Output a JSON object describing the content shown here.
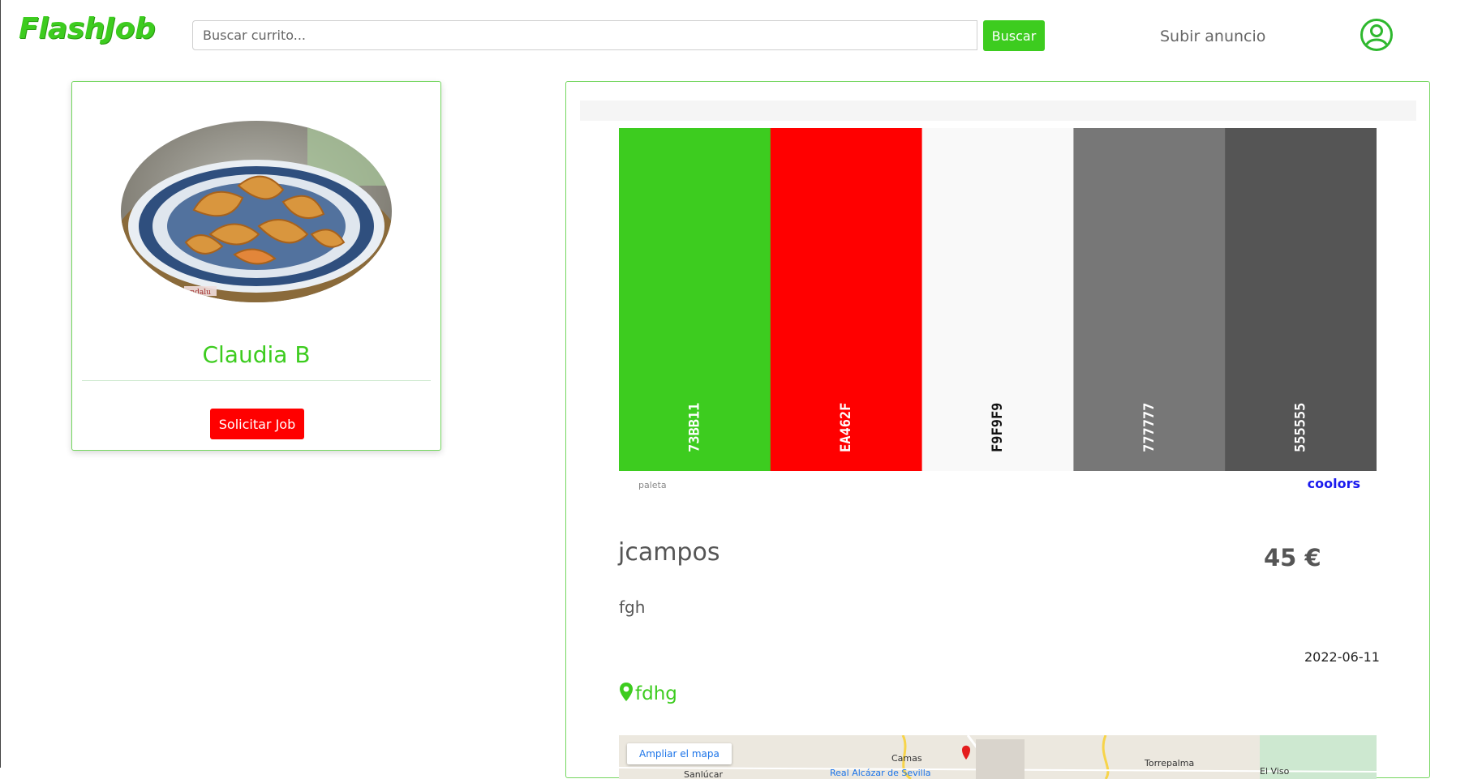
{
  "header": {
    "logo": "FlashJob",
    "search_placeholder": "Buscar currito...",
    "search_button": "Buscar",
    "post_link": "Subir anuncio",
    "user_icon": "user-circle-icon"
  },
  "profile": {
    "name": "Claudia B",
    "photo_watermark": "andalu",
    "request_button": "Solicitar Job"
  },
  "job": {
    "title": "jcampos",
    "price": "45 €",
    "description": "fgh",
    "date": "2022-06-11",
    "location": "fdhg",
    "location_icon": "map-pin-icon",
    "palette": {
      "swatches": [
        {
          "label": "73BB11",
          "color": "#3dcc1f",
          "text_color": "#ffffff"
        },
        {
          "label": "EA462F",
          "color": "#ff0000",
          "text_color": "#ffffff"
        },
        {
          "label": "F9F9F9",
          "color": "#f9f9f9",
          "text_color": "#111111"
        },
        {
          "label": "777777",
          "color": "#777777",
          "text_color": "#ffffff"
        },
        {
          "label": "555555",
          "color": "#555555",
          "text_color": "#ffffff"
        }
      ],
      "caption": "paleta",
      "brand": "coolors"
    },
    "map": {
      "expand_button": "Ampliar el mapa",
      "places": [
        "Camas",
        "Torrepalma",
        "El Viso",
        "Sanlúcar",
        "Real Alcázar de Sevilla"
      ]
    }
  },
  "colors": {
    "accent": "#3dcc1f",
    "danger": "#ff0000",
    "text": "#555555"
  }
}
